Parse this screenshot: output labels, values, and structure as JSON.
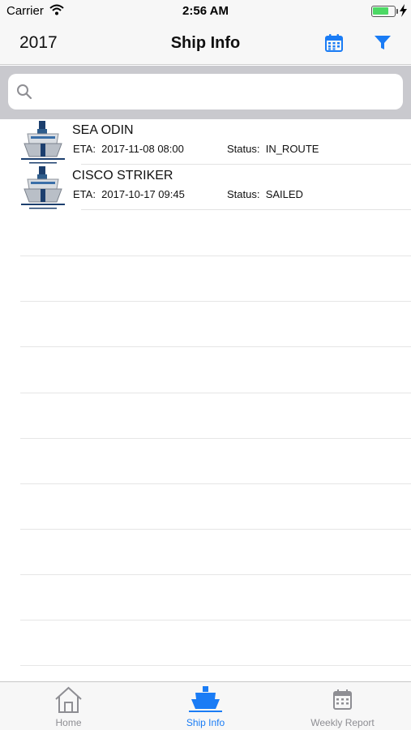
{
  "status_bar": {
    "carrier": "Carrier",
    "time": "2:56 AM",
    "battery_level": 0.75,
    "wifi_icon": "wifi-icon",
    "charging_icon": "bolt-icon"
  },
  "nav": {
    "year": "2017",
    "title": "Ship Info",
    "calendar_icon": "calendar-icon",
    "filter_icon": "filter-icon"
  },
  "search": {
    "value": "",
    "placeholder": ""
  },
  "ships": [
    {
      "name": "SEA ODIN",
      "eta_label": "ETA:",
      "eta": "2017-11-08 08:00",
      "status_label": "Status:",
      "status": "IN_ROUTE"
    },
    {
      "name": "CISCO STRIKER",
      "eta_label": "ETA:",
      "eta": "2017-10-17 09:45",
      "status_label": "Status:",
      "status": "SAILED"
    }
  ],
  "tabs": [
    {
      "label": "Home",
      "icon": "home-icon",
      "active": false
    },
    {
      "label": "Ship Info",
      "icon": "ship-icon",
      "active": true
    },
    {
      "label": "Weekly Report",
      "icon": "calendar-icon",
      "active": false
    }
  ],
  "colors": {
    "accent": "#1a7cf5",
    "inactive": "#8e8e93",
    "search_bg": "#c9c9ce",
    "battery": "#4cd964"
  }
}
